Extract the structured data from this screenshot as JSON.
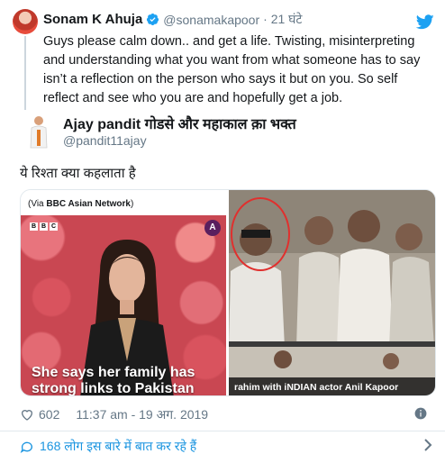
{
  "quoted_tweet": {
    "name": "Sonam K Ahuja",
    "handle": "@sonamakapoor",
    "time": "21 घंटे",
    "text": "Guys please calm down.. and get a life. Twisting, misinterpreting and understanding what you want from what someone has to say isn’t a reflection on the person who says it but on you. So self reflect and see who you are and hopefully get a job."
  },
  "author": {
    "name": "Ajay pandit गोडसे और महाकाल क़ा भक्त",
    "handle": "@pandit11ajay"
  },
  "tweet": {
    "text": "ये रिश्ता क्या कहलाता है"
  },
  "media": {
    "left": {
      "via_prefix": "(Via ",
      "via_source": "BBC Asian Network",
      "via_suffix": ")",
      "bbc_letters": [
        "B",
        "B",
        "C"
      ],
      "network_badge": "A",
      "caption": "She says her family has strong links to Pakistan"
    },
    "right": {
      "caption": "rahim with iNDIAN actor Anil Kapoor"
    }
  },
  "meta": {
    "likes": "602",
    "timestamp": "11:37 am - 19 अग. 2019"
  },
  "conversation": {
    "label": "168 लोग इस बारे में बात कर रहे हैं"
  },
  "colors": {
    "link_blue": "#1b95e0",
    "twitter_blue": "#1da1f2",
    "muted_gray": "#657786",
    "verified_blue": "#1da1f2"
  }
}
